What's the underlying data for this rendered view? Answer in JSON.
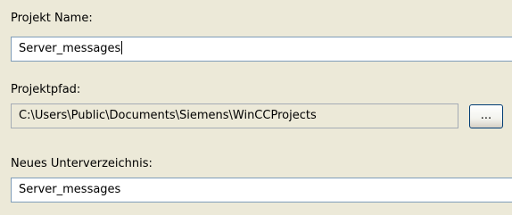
{
  "project_name": {
    "label": "Projekt Name:",
    "value": "Server_messages"
  },
  "project_path": {
    "label": "Projektpfad:",
    "value": "C:\\Users\\Public\\Documents\\Siemens\\WinCCProjects",
    "browse_label": "..."
  },
  "subdirectory": {
    "label": "Neues Unterverzeichnis:",
    "value": "Server_messages"
  }
}
